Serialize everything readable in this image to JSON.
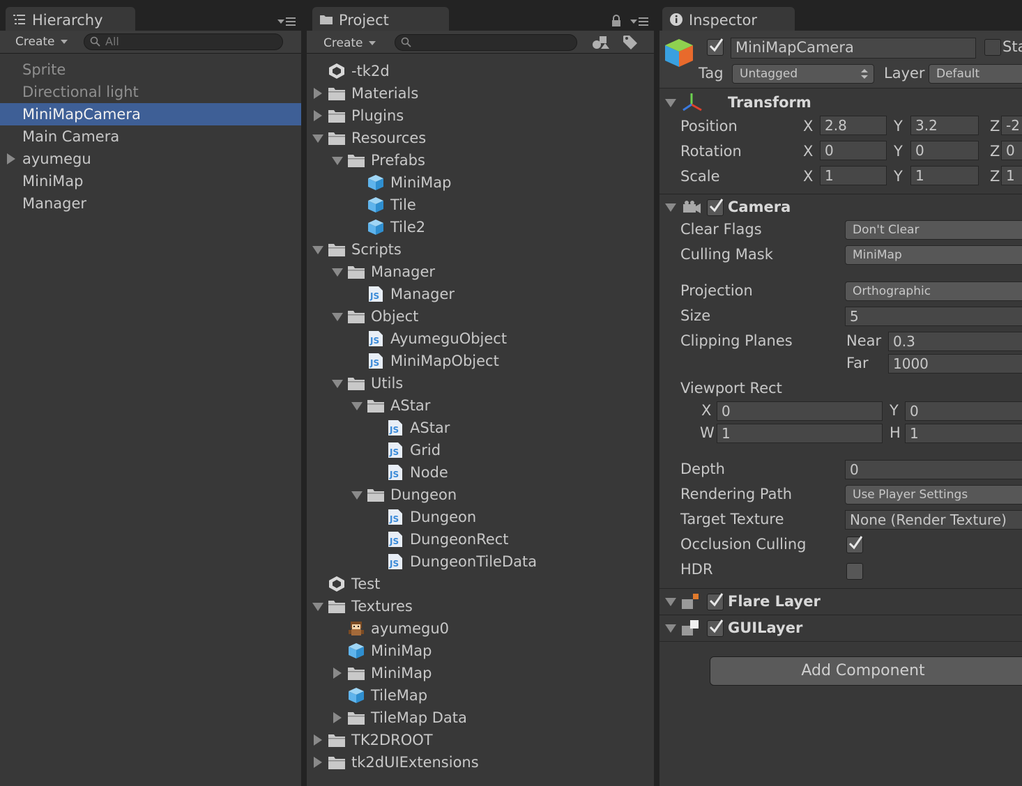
{
  "hierarchy": {
    "tab_label": "Hierarchy",
    "create_label": "Create",
    "search_placeholder": "All",
    "items": [
      {
        "label": "Sprite",
        "dim": true
      },
      {
        "label": "Directional light",
        "dim": true
      },
      {
        "label": "MiniMapCamera",
        "selected": true
      },
      {
        "label": "Main Camera"
      },
      {
        "label": "ayumegu",
        "expandable": true
      },
      {
        "label": "MiniMap"
      },
      {
        "label": "Manager"
      }
    ]
  },
  "project": {
    "tab_label": "Project",
    "create_label": "Create",
    "search_placeholder": "",
    "items": [
      {
        "label": "-tk2d",
        "depth": 0,
        "icon": "unity-scene-icon",
        "arrow": "none"
      },
      {
        "label": "Materials",
        "depth": 0,
        "icon": "folder-icon",
        "arrow": "right"
      },
      {
        "label": "Plugins",
        "depth": 0,
        "icon": "folder-icon",
        "arrow": "right"
      },
      {
        "label": "Resources",
        "depth": 0,
        "icon": "folder-icon",
        "arrow": "down"
      },
      {
        "label": "Prefabs",
        "depth": 1,
        "icon": "folder-icon",
        "arrow": "down"
      },
      {
        "label": "MiniMap",
        "depth": 2,
        "icon": "prefab-cube-icon",
        "arrow": "none"
      },
      {
        "label": "Tile",
        "depth": 2,
        "icon": "prefab-cube-icon",
        "arrow": "none"
      },
      {
        "label": "Tile2",
        "depth": 2,
        "icon": "prefab-cube-icon",
        "arrow": "none"
      },
      {
        "label": "Scripts",
        "depth": 0,
        "icon": "folder-icon",
        "arrow": "down"
      },
      {
        "label": "Manager",
        "depth": 1,
        "icon": "folder-icon",
        "arrow": "down"
      },
      {
        "label": "Manager",
        "depth": 2,
        "icon": "js-script-icon",
        "arrow": "none"
      },
      {
        "label": "Object",
        "depth": 1,
        "icon": "folder-icon",
        "arrow": "down"
      },
      {
        "label": "AyumeguObject",
        "depth": 2,
        "icon": "js-script-icon",
        "arrow": "none"
      },
      {
        "label": "MiniMapObject",
        "depth": 2,
        "icon": "js-script-icon",
        "arrow": "none"
      },
      {
        "label": "Utils",
        "depth": 1,
        "icon": "folder-icon",
        "arrow": "down"
      },
      {
        "label": "AStar",
        "depth": 2,
        "icon": "folder-icon",
        "arrow": "down"
      },
      {
        "label": "AStar",
        "depth": 3,
        "icon": "js-script-icon",
        "arrow": "none"
      },
      {
        "label": "Grid",
        "depth": 3,
        "icon": "js-script-icon",
        "arrow": "none"
      },
      {
        "label": "Node",
        "depth": 3,
        "icon": "js-script-icon",
        "arrow": "none"
      },
      {
        "label": "Dungeon",
        "depth": 2,
        "icon": "folder-icon",
        "arrow": "down"
      },
      {
        "label": "Dungeon",
        "depth": 3,
        "icon": "js-script-icon",
        "arrow": "none"
      },
      {
        "label": "DungeonRect",
        "depth": 3,
        "icon": "js-script-icon",
        "arrow": "none"
      },
      {
        "label": "DungeonTileData",
        "depth": 3,
        "icon": "js-script-icon",
        "arrow": "none"
      },
      {
        "label": "Test",
        "depth": 0,
        "icon": "unity-scene-icon",
        "arrow": "none"
      },
      {
        "label": "Textures",
        "depth": 0,
        "icon": "folder-icon",
        "arrow": "down"
      },
      {
        "label": "ayumegu0",
        "depth": 1,
        "icon": "sprite-character-icon",
        "arrow": "none"
      },
      {
        "label": "MiniMap",
        "depth": 1,
        "icon": "prefab-cube-icon",
        "arrow": "none"
      },
      {
        "label": "MiniMap",
        "depth": 1,
        "icon": "folder-icon",
        "arrow": "right"
      },
      {
        "label": "TileMap",
        "depth": 1,
        "icon": "prefab-cube-icon",
        "arrow": "none"
      },
      {
        "label": "TileMap Data",
        "depth": 1,
        "icon": "folder-icon",
        "arrow": "right"
      },
      {
        "label": "TK2DROOT",
        "depth": 0,
        "icon": "folder-icon",
        "arrow": "right"
      },
      {
        "label": "tk2dUIExtensions",
        "depth": 0,
        "icon": "folder-icon",
        "arrow": "right"
      }
    ]
  },
  "inspector": {
    "tab_label": "Inspector",
    "object_name": "MiniMapCamera",
    "static_label": "Sta",
    "tag_label": "Tag",
    "tag_value": "Untagged",
    "layer_label": "Layer",
    "layer_value": "Default",
    "transform": {
      "title": "Transform",
      "position_label": "Position",
      "rotation_label": "Rotation",
      "scale_label": "Scale",
      "axis_x": "X",
      "axis_y": "Y",
      "axis_z": "Z",
      "position": {
        "x": "2.8",
        "y": "3.2",
        "z": "-2"
      },
      "rotation": {
        "x": "0",
        "y": "0",
        "z": "0"
      },
      "scale": {
        "x": "1",
        "y": "1",
        "z": "1"
      }
    },
    "camera": {
      "title": "Camera",
      "clear_flags_label": "Clear Flags",
      "clear_flags_value": "Don't Clear",
      "culling_mask_label": "Culling Mask",
      "culling_mask_value": "MiniMap",
      "projection_label": "Projection",
      "projection_value": "Orthographic",
      "size_label": "Size",
      "size_value": "5",
      "clipping_label": "Clipping Planes",
      "near_label": "Near",
      "near_value": "0.3",
      "far_label": "Far",
      "far_value": "1000",
      "viewport_label": "Viewport Rect",
      "vx_label": "X",
      "vx_value": "0",
      "vy_label": "Y",
      "vy_value": "0",
      "vw_label": "W",
      "vw_value": "1",
      "vh_label": "H",
      "vh_value": "1",
      "depth_label": "Depth",
      "depth_value": "0",
      "rendering_label": "Rendering Path",
      "rendering_value": "Use Player Settings",
      "target_label": "Target Texture",
      "target_value": "None (Render Texture)",
      "occlusion_label": "Occlusion Culling",
      "occlusion_checked": true,
      "hdr_label": "HDR",
      "hdr_checked": false
    },
    "flare_layer_title": "Flare Layer",
    "gui_layer_title": "GUILayer",
    "add_component_label": "Add Component"
  },
  "colors": {
    "selection": "#3e5f96",
    "panel": "#383838",
    "tabbar": "#232323",
    "script_blue": "#3a8ad8",
    "prefab_blue": "#5fb4ec",
    "folder_grey": "#c9c9c9"
  }
}
